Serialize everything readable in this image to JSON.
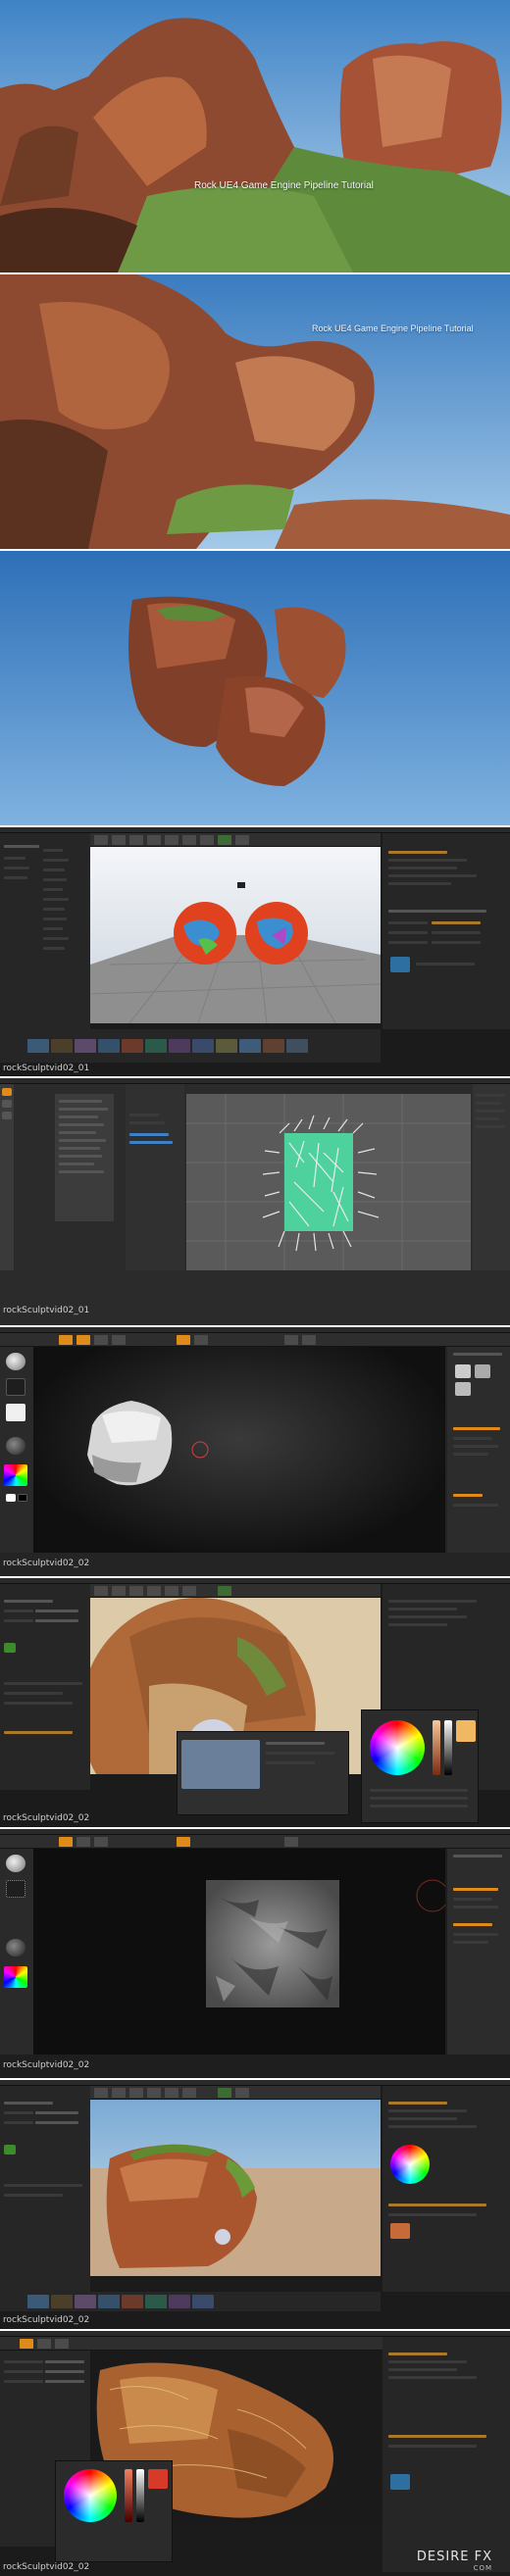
{
  "frames": [
    {
      "id": "render-1",
      "title": "Rock UE4 Game Engine Pipeline Tutorial"
    },
    {
      "id": "render-2",
      "title": "Rock UE4 Game Engine Pipeline Tutorial"
    },
    {
      "id": "render-3",
      "title": ""
    },
    {
      "id": "ue4-material-preview",
      "caption": "rockSculptvid02_01"
    },
    {
      "id": "hair-fibers",
      "caption": "rockSculptvid02_01"
    },
    {
      "id": "zbrush-sculpt",
      "caption": "rockSculptvid02_02"
    },
    {
      "id": "ue4-material-sphere",
      "caption": "rockSculptvid02_02"
    },
    {
      "id": "zbrush-alpha",
      "caption": "rockSculptvid02_02"
    },
    {
      "id": "ue4-rock-viewport",
      "caption": "rockSculptvid02_02"
    },
    {
      "id": "texture-paint",
      "caption": "rockSculptvid02_02"
    }
  ],
  "watermark": {
    "text": "DESIRE FX",
    "subtext": "COM"
  },
  "icons": {
    "play": "play-icon",
    "brush": "brush-icon",
    "color-picker": "color-wheel-icon",
    "sphere": "material-sphere-icon"
  },
  "colors": {
    "sky_top": "#3f83c6",
    "sky_bottom": "#a8cbe9",
    "rock": "#a8553a",
    "ui_bg": "#1b1b1b",
    "ui_accent": "#e08a1a"
  }
}
